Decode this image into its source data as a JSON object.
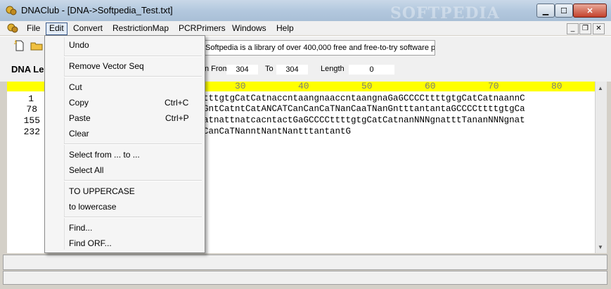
{
  "window": {
    "title": "DNAClub - [DNA->Softpedia_Test.txt]",
    "watermark": "SOFTPEDIA"
  },
  "menubar": [
    "File",
    "Edit",
    "Convert",
    "RestrictionMap",
    "PCRPrimers",
    "Windows",
    "Help"
  ],
  "toolbar": {
    "info_text": "Softpedia is a library of over 400,000 free and free-to-try software pro"
  },
  "seqinfo": {
    "label_partial": "DNA Le",
    "from_label_partial": "n From",
    "from_value": "304",
    "to_label": "To",
    "to_value": "304",
    "length_label": "Length",
    "length_value": "0"
  },
  "ruler": [
    "30",
    "40",
    "50",
    "60",
    "70",
    "80"
  ],
  "rows": [
    {
      "num": "1",
      "seq": "tttgtgCatCatnaccntaangnaaccntaangnaGaGCCCCttttgtgCatCatnaannC"
    },
    {
      "num": "78",
      "seq": "GntCatntCatANCATCanCanCaTNanCaaTNanGntttantantaGCCCCttttgtgCa"
    },
    {
      "num": "155",
      "seq": "atnattnatcacntactGaGCCCCttttgtgCatCatnanNNNgnatttTananNNNgnat"
    },
    {
      "num": "232",
      "seq": "CanCaTNanntNantNantttantantG"
    }
  ],
  "edit_menu": {
    "undo": "Undo",
    "remove_vector": "Remove Vector Seq",
    "cut": "Cut",
    "copy": "Copy",
    "copy_shortcut": "Ctrl+C",
    "paste": "Paste",
    "paste_shortcut": "Ctrl+P",
    "clear": "Clear",
    "select_from": "Select from ... to ...",
    "select_all": "Select All",
    "uppercase": "TO UPPERCASE",
    "lowercase": "to lowercase",
    "find": "Find...",
    "find_orf": "Find ORF..."
  },
  "colors": {
    "ruler_bg": "#ffff00",
    "ruler_text": "#7c7c7c",
    "active_menu_border": "#3a5a8a"
  }
}
